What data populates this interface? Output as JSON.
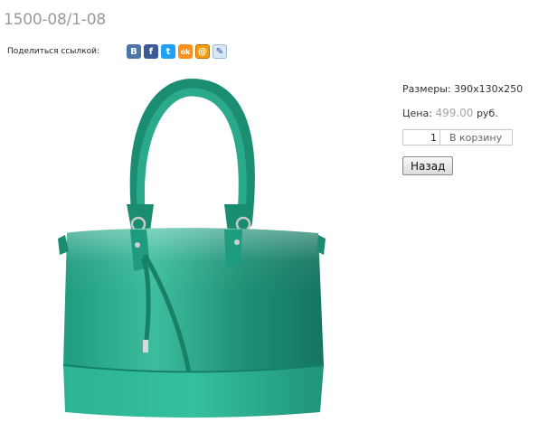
{
  "product": {
    "title": "1500-08/1-08"
  },
  "share": {
    "label": "Поделиться ссылкой:",
    "icons": [
      {
        "name": "vk-icon",
        "glyph": "B",
        "color": "#4a76a8"
      },
      {
        "name": "facebook-icon",
        "glyph": "f",
        "color": "#3b5998"
      },
      {
        "name": "twitter-icon",
        "glyph": "t",
        "color": "#1da1f2"
      },
      {
        "name": "odnoklassniki-icon",
        "glyph": "ok",
        "color": "#f7931e"
      },
      {
        "name": "mailru-icon",
        "glyph": "@",
        "color": "#f39c12"
      },
      {
        "name": "livejournal-icon",
        "glyph": "✎",
        "color": "#d8e6f5"
      }
    ]
  },
  "info": {
    "size_label": "Размеры:",
    "size_value": "390x130x250",
    "price_label": "Цена:",
    "price_value": "499.00",
    "price_currency": "руб.",
    "quantity": "1",
    "cart_button": "В корзину",
    "back_button": "Назад"
  },
  "colors": {
    "bag": "#2aa98b",
    "bag_dark": "#137a63",
    "title": "#9a9a9a",
    "price": "#a4a4a4"
  }
}
